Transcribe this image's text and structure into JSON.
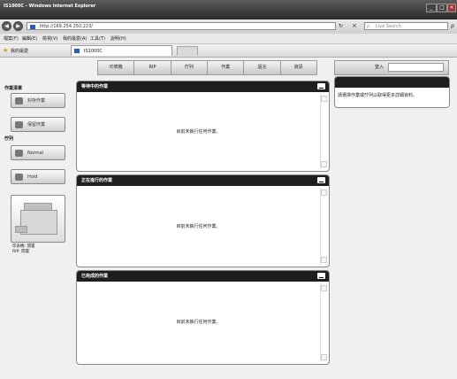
{
  "window": {
    "title": "IS1000C - Windows Internet Explorer"
  },
  "browser": {
    "address": "http://169.254.250.223/",
    "search_placeholder": "Live Search",
    "menu": [
      "檔案(F)",
      "編輯(E)",
      "檢視(V)",
      "我的最愛(A)",
      "工具(T)",
      "說明(H)"
    ],
    "favorites_label": "我的最愛",
    "tab_title": "IS1000C"
  },
  "topnav": {
    "items": [
      "印表機",
      "RIP",
      "佇列",
      "作業",
      "語言",
      "資訊"
    ]
  },
  "login": {
    "label": "登入"
  },
  "sidebar": {
    "jobs_header": "作業清單",
    "stored_jobs": "封存作業",
    "held_jobs": "保留作業",
    "queue_header": "佇列",
    "normal": "Normal",
    "hold": "Hold",
    "printer_status": "印表機: 閒置",
    "rip_status": "RIP: 閒置"
  },
  "panels": {
    "waiting": {
      "title": "等待中的作業",
      "empty": "目前未執行任何作業。"
    },
    "running": {
      "title": "正在進行的作業",
      "empty": "目前未執行任何作業。"
    },
    "done": {
      "title": "已完成的作業",
      "empty": "目前未執行任何作業。"
    }
  },
  "right_panel": {
    "text": "請選擇作業或佇列以取得更多詳細資料。"
  }
}
